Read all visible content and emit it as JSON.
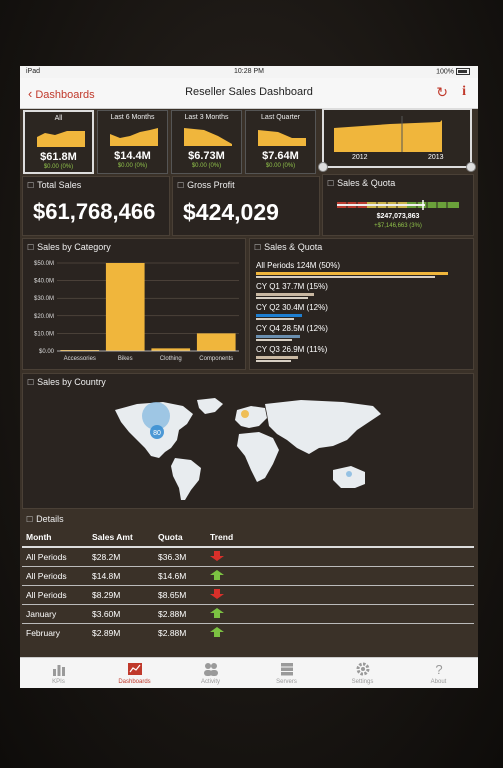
{
  "status_bar": {
    "device": "iPad",
    "time": "10:28 PM",
    "battery": "100%"
  },
  "nav": {
    "back_label": "Dashboards",
    "title": "Reseller Sales Dashboard"
  },
  "kpis": [
    {
      "label": "All",
      "value": "$61.8M",
      "change": "$0.00 (0%)",
      "selected": true
    },
    {
      "label": "Last 6 Months",
      "value": "$14.4M",
      "change": "$0.00 (0%)"
    },
    {
      "label": "Last 3 Months",
      "value": "$6.73M",
      "change": "$0.00 (0%)"
    },
    {
      "label": "Last Quarter",
      "value": "$7.64M",
      "change": "$0.00 (0%)"
    }
  ],
  "year_range": {
    "start": "2012",
    "end": "2013"
  },
  "total_sales": {
    "title": "Total Sales",
    "value": "$61,768,466"
  },
  "gross_profit": {
    "title": "Gross Profit",
    "value": "$424,029"
  },
  "sales_quota_gauge": {
    "title": "Sales & Quota",
    "value": "$247,073,863",
    "delta": "+$7,146,663 (3%)",
    "delta_color": "#8fc04a"
  },
  "category_chart": {
    "title": "Sales by Category",
    "chart_data": {
      "type": "bar",
      "categories": [
        "Accessories",
        "Bikes",
        "Clothing",
        "Components"
      ],
      "values": [
        0.2,
        50.0,
        1.5,
        10.0
      ],
      "ylim": [
        0,
        50
      ],
      "yticks": [
        "$0.00",
        "$10.0M",
        "$20.0M",
        "$30.0M",
        "$40.0M",
        "$50.0M"
      ],
      "bar_color": "#f0b63c"
    }
  },
  "sales_quota_list": {
    "title": "Sales & Quota",
    "items": [
      {
        "label": "All Periods 124M (50%)",
        "sales_fraction": 1.0,
        "quota_fraction": 0.93,
        "color": "#f0b63c"
      },
      {
        "label": "CY Q1 37.7M (15%)",
        "sales_fraction": 0.3,
        "quota_fraction": 0.27,
        "color": "#c9b8a2"
      },
      {
        "label": "CY Q2 30.4M (12%)",
        "sales_fraction": 0.24,
        "quota_fraction": 0.2,
        "color": "#1e7fd1"
      },
      {
        "label": "CY Q4 28.5M (12%)",
        "sales_fraction": 0.23,
        "quota_fraction": 0.19,
        "color": "#6a8fb0"
      },
      {
        "label": "CY Q3 26.9M (11%)",
        "sales_fraction": 0.22,
        "quota_fraction": 0.18,
        "color": "#c9b8a2"
      }
    ]
  },
  "country_map": {
    "title": "Sales by Country",
    "bubble_label": "80"
  },
  "details": {
    "title": "Details",
    "columns": [
      "Month",
      "Sales Amt",
      "Quota",
      "Trend"
    ],
    "rows": [
      {
        "month": "All Periods",
        "sales": "$28.2M",
        "quota": "$36.3M",
        "trend": "down"
      },
      {
        "month": "All Periods",
        "sales": "$14.8M",
        "quota": "$14.6M",
        "trend": "up"
      },
      {
        "month": "All Periods",
        "sales": "$8.29M",
        "quota": "$8.65M",
        "trend": "down"
      },
      {
        "month": "January",
        "sales": "$3.60M",
        "quota": "$2.88M",
        "trend": "up"
      },
      {
        "month": "February",
        "sales": "$2.89M",
        "quota": "$2.88M",
        "trend": "up"
      }
    ],
    "colors": {
      "up": "#7cc242",
      "down": "#d9302a"
    }
  },
  "tabs": [
    {
      "label": "KPIs",
      "icon": "bar-chart-icon"
    },
    {
      "label": "Dashboards",
      "icon": "dashboard-icon",
      "active": true
    },
    {
      "label": "Activity",
      "icon": "people-icon"
    },
    {
      "label": "Servers",
      "icon": "server-icon"
    },
    {
      "label": "Settings",
      "icon": "gear-icon"
    },
    {
      "label": "About",
      "icon": "question-icon"
    }
  ]
}
